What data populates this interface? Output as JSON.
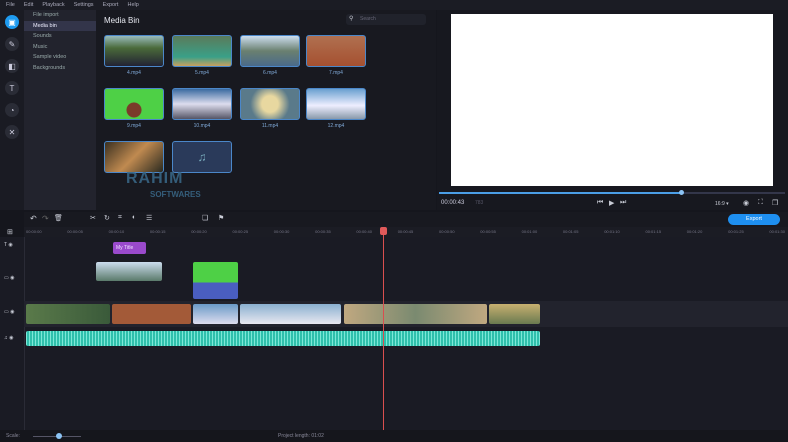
{
  "menu": [
    "File",
    "Edit",
    "Playback",
    "Settings",
    "Export",
    "Help"
  ],
  "rail_icons": [
    "import-icon",
    "magic-wand-icon",
    "transitions-icon",
    "titles-icon",
    "stickers-icon",
    "tools-icon"
  ],
  "categories": [
    "File import",
    "Media bin",
    "Sounds",
    "Music",
    "Sample video",
    "Backgrounds"
  ],
  "media_bin": {
    "title": "Media Bin",
    "search_placeholder": "Search",
    "items": [
      {
        "label": "4.mp4"
      },
      {
        "label": "5.mp4"
      },
      {
        "label": "6.mp4"
      },
      {
        "label": "7.mp4"
      },
      {
        "label": "9.mp4"
      },
      {
        "label": "10.mp4"
      },
      {
        "label": "11.mp4"
      },
      {
        "label": "12.mp4"
      }
    ]
  },
  "watermark": {
    "line1": "RAHIM",
    "line2": "SOFTWARES"
  },
  "player": {
    "time": "00:00:43",
    "frac": "783",
    "progress": 0.7,
    "aspect": "16:9 ▾"
  },
  "toolbar": {
    "export_label": "Export"
  },
  "ruler": [
    "00:00:00",
    "00:00:05",
    "00:00:10",
    "00:00:15",
    "00:00:20",
    "00:00:25",
    "00:00:30",
    "00:00:35",
    "00:00:40",
    "00:00:45",
    "00:00:50",
    "00:00:55",
    "00:01:00",
    "00:01:05",
    "00:01:10",
    "00:01:15",
    "00:01:20",
    "00:01:25",
    "00:01:30"
  ],
  "title_clip": "My Title",
  "bottom": {
    "scale_label": "Scale:",
    "project_length": "Project length: 01:02"
  }
}
